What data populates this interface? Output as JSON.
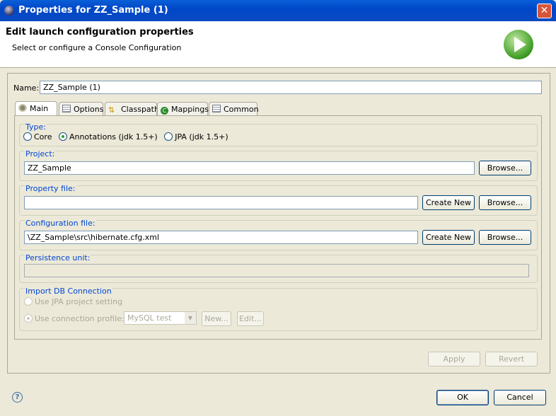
{
  "window": {
    "title": "Properties for ZZ_Sample (1)",
    "close": "✕"
  },
  "header": {
    "title": "Edit launch configuration properties",
    "subtitle": "Select or configure a Console Configuration"
  },
  "name": {
    "label": "Name:",
    "value": "ZZ_Sample (1)"
  },
  "tabs": [
    {
      "label": "Main"
    },
    {
      "label": "Options"
    },
    {
      "label": "Classpath"
    },
    {
      "label": "Mappings"
    },
    {
      "label": "Common"
    }
  ],
  "type": {
    "label": "Type:",
    "options": [
      {
        "label": "Core",
        "selected": false
      },
      {
        "label": "Annotations (jdk 1.5+)",
        "selected": true
      },
      {
        "label": "JPA (jdk 1.5+)",
        "selected": false
      }
    ]
  },
  "project": {
    "label": "Project:",
    "value": "ZZ_Sample",
    "browse": "Browse..."
  },
  "property_file": {
    "label": "Property file:",
    "value": "",
    "create": "Create New",
    "browse": "Browse..."
  },
  "config_file": {
    "label": "Configuration file:",
    "value": "\\ZZ_Sample\\src\\hibernate.cfg.xml",
    "create": "Create New",
    "browse": "Browse..."
  },
  "persistence": {
    "label": "Persistence unit:",
    "value": ""
  },
  "import_db": {
    "label": "Import DB Connection",
    "use_jpa": "Use JPA project setting",
    "use_profile": "Use connection profile:",
    "profile": "MySQL test",
    "new": "New...",
    "edit": "Edit..."
  },
  "actions": {
    "apply": "Apply",
    "revert": "Revert",
    "ok": "OK",
    "cancel": "Cancel",
    "help": "?"
  }
}
